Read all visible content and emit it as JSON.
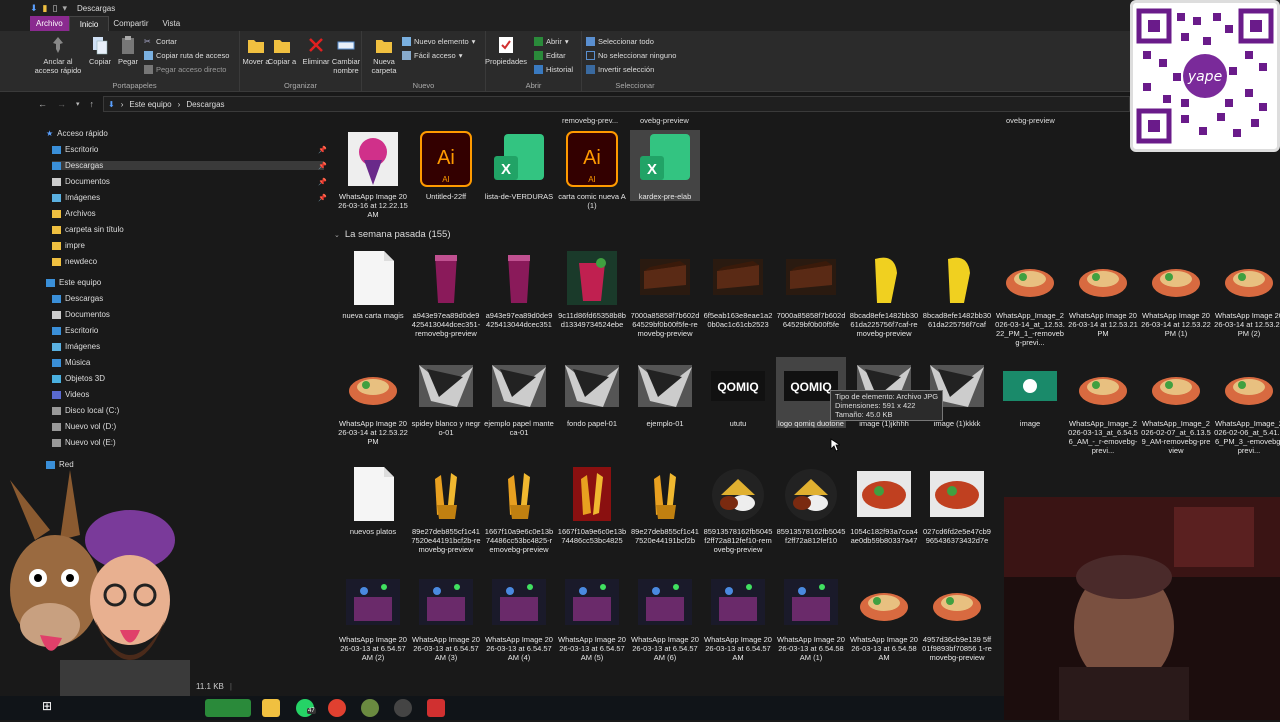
{
  "window": {
    "title": "Descargas"
  },
  "menu": {
    "tabs": [
      "Archivo",
      "Inicio",
      "Compartir",
      "Vista"
    ],
    "active": "Inicio"
  },
  "ribbon": {
    "portapapeles": {
      "label": "Portapapeles",
      "pin": "Anclar al acceso rápido",
      "copy": "Copiar",
      "paste": "Pegar",
      "cut": "Cortar",
      "copy_path": "Copiar ruta de acceso",
      "paste_shortcut": "Pegar acceso directo"
    },
    "organizar": {
      "label": "Organizar",
      "move": "Mover a",
      "copy_to": "Copiar a",
      "delete": "Eliminar",
      "rename": "Cambiar nombre"
    },
    "nuevo": {
      "label": "Nuevo",
      "new_folder": "Nueva carpeta",
      "new_item": "Nuevo elemento",
      "easy_access": "Fácil acceso"
    },
    "abrir": {
      "label": "Abrir",
      "properties": "Propiedades",
      "open": "Abrir",
      "edit": "Editar",
      "history": "Historial"
    },
    "seleccionar": {
      "label": "Seleccionar",
      "select_all": "Seleccionar todo",
      "select_none": "No seleccionar ninguno",
      "invert": "Invertir selección"
    }
  },
  "address": {
    "segments": [
      "Este equipo",
      "Descargas"
    ]
  },
  "nav": {
    "quick_access": "Acceso rápido",
    "quick_items": [
      "Escritorio",
      "Descargas",
      "Documentos",
      "Imágenes",
      "Archivos",
      "carpeta sin título",
      "impre",
      "newdeco"
    ],
    "this_pc": "Este equipo",
    "pc_items": [
      "Descargas",
      "Documentos",
      "Escritorio",
      "Imágenes",
      "Música",
      "Objetos 3D",
      "Videos",
      "Disco local (C:)",
      "Nuevo vol (D:)",
      "Nuevo vol (E:)"
    ],
    "network": "Red"
  },
  "content": {
    "top_labels": [
      "removebg-prev...",
      "ovebg-preview",
      "ovebg-preview"
    ],
    "row0": [
      {
        "name": "WhatsApp Image 2026-03-16 at 12.22.15 AM",
        "kind": "bouquet"
      },
      {
        "name": "Untitled-22ff",
        "kind": "ai"
      },
      {
        "name": "lista-de-VERDURAS",
        "kind": "xls"
      },
      {
        "name": "carta comic nueva A(1)",
        "kind": "ai"
      },
      {
        "name": "kardex-pre-elab",
        "kind": "xls"
      }
    ],
    "section": "La semana pasada (155)",
    "row1": [
      {
        "name": "nueva carta magis",
        "kind": "doc"
      },
      {
        "name": "a943e97ea89d0de9425413044dcec351-removebg-preview",
        "kind": "drink"
      },
      {
        "name": "a943e97ea89d0de9425413044dcec351",
        "kind": "drink"
      },
      {
        "name": "9c11d86fd65358b8bd13349734524ebe",
        "kind": "drink2"
      },
      {
        "name": "7000a85858f7b602d64529bf0b00f5fe-removebg-preview",
        "kind": "cake"
      },
      {
        "name": "6f5eab163e8eae1a20b0ac1c61cb2523",
        "kind": "cake"
      },
      {
        "name": "7000a85858f7b602d64529bf0b00f5fe",
        "kind": "cake"
      },
      {
        "name": "8bcad8efe1482bb3061da225756f7caf-removebg-preview",
        "kind": "yellow"
      },
      {
        "name": "8bcad8efe1482bb3061da225756f7caf",
        "kind": "yellow"
      },
      {
        "name": "WhatsApp_Image_2026-03-14_at_12.53.22_PM_1_-removebg-previ...",
        "kind": "food"
      },
      {
        "name": "WhatsApp Image 2026-03-14 at 12.53.21 PM",
        "kind": "food"
      },
      {
        "name": "WhatsApp Image 2026-03-14 at 12.53.22 PM (1)",
        "kind": "food"
      },
      {
        "name": "WhatsApp Image 2026-03-14 at 12.53.22 PM (2)",
        "kind": "food"
      }
    ],
    "row2": [
      {
        "name": "WhatsApp Image 2026-03-14 at 12.53.22 PM",
        "kind": "food"
      },
      {
        "name": "spidey blanco y negro-01",
        "kind": "bw"
      },
      {
        "name": "ejemplo papel manteca-01",
        "kind": "bw"
      },
      {
        "name": "fondo papel-01",
        "kind": "bw"
      },
      {
        "name": "ejemplo-01",
        "kind": "bw"
      },
      {
        "name": "ututu",
        "kind": "logo"
      },
      {
        "name": "logo qomiq duotone",
        "kind": "logo"
      },
      {
        "name": "image (1)jkhhh",
        "kind": "bw"
      },
      {
        "name": "image (1)kkkk",
        "kind": "bw"
      },
      {
        "name": "image",
        "kind": "green"
      },
      {
        "name": "WhatsApp_Image_2026-03-13_at_6.54.56_AM_-_r-emovebg-previ...",
        "kind": "food"
      },
      {
        "name": "WhatsApp_Image_2026-02-07_at_6.13.59_AM-removebg-preview",
        "kind": "food"
      },
      {
        "name": "WhatsApp_Image_2026-02-06_at_5.41.16_PM_3_-emovebg-previ...",
        "kind": "food"
      }
    ],
    "row3": [
      {
        "name": "nuevos platos",
        "kind": "doc"
      },
      {
        "name": "89e27deb855cf1c417520e44191bcf2b-removebg-preview",
        "kind": "fries"
      },
      {
        "name": "1667f10a9e6c0e13b74486cc53bc4825-removebg-preview",
        "kind": "fries"
      },
      {
        "name": "1667f10a9e6c0e13b74486cc53bc4825",
        "kind": "friesred"
      },
      {
        "name": "89e27deb855cf1c417520e44191bcf2b",
        "kind": "fries"
      },
      {
        "name": "85913578162fb5045f2ff72a812fef10-removebg-preview",
        "kind": "plate"
      },
      {
        "name": "85913578162fb5045f2ff72a812fef10",
        "kind": "plate"
      },
      {
        "name": "1054c182f93a7cca4ae0db59b80337a47",
        "kind": "plate2"
      },
      {
        "name": "027cd6fd2e5e47cb9965436373432d7e",
        "kind": "plate2"
      }
    ],
    "row4": [
      {
        "name": "WhatsApp Image 2026-03-13 at 6.54.57 AM (2)",
        "kind": "night"
      },
      {
        "name": "WhatsApp Image 2026-03-13 at 6.54.57 AM (3)",
        "kind": "night"
      },
      {
        "name": "WhatsApp Image 2026-03-13 at 6.54.57 AM (4)",
        "kind": "night"
      },
      {
        "name": "WhatsApp Image 2026-03-13 at 6.54.57 AM (5)",
        "kind": "night"
      },
      {
        "name": "WhatsApp Image 2026-03-13 at 6.54.57 AM (6)",
        "kind": "night"
      },
      {
        "name": "WhatsApp Image 2026-03-13 at 6.54.57 AM",
        "kind": "night"
      },
      {
        "name": "WhatsApp Image 2026-03-13 at 6.54.58 AM (1)",
        "kind": "night"
      },
      {
        "name": "WhatsApp Image 2026-03-13 at 6.54.58 AM",
        "kind": "food"
      },
      {
        "name": "4957d36cb9e139 5ff01f9893bf70856 1-removebg-preview",
        "kind": "food"
      }
    ],
    "tooltip": [
      "Tipo de elemento: Archivo JPG",
      "Dimensiones: 591 x 422",
      "Tamaño: 45.0 KB"
    ]
  },
  "status": {
    "size": "11.1 KB"
  },
  "taskbar": {
    "whatsapp_badge": "47"
  },
  "colors": {
    "accent": "#8a2a8f",
    "folder": "#f0c040",
    "excel": "#21a366",
    "illustrator_bg": "#330000",
    "illustrator_fg": "#ff9a00"
  }
}
